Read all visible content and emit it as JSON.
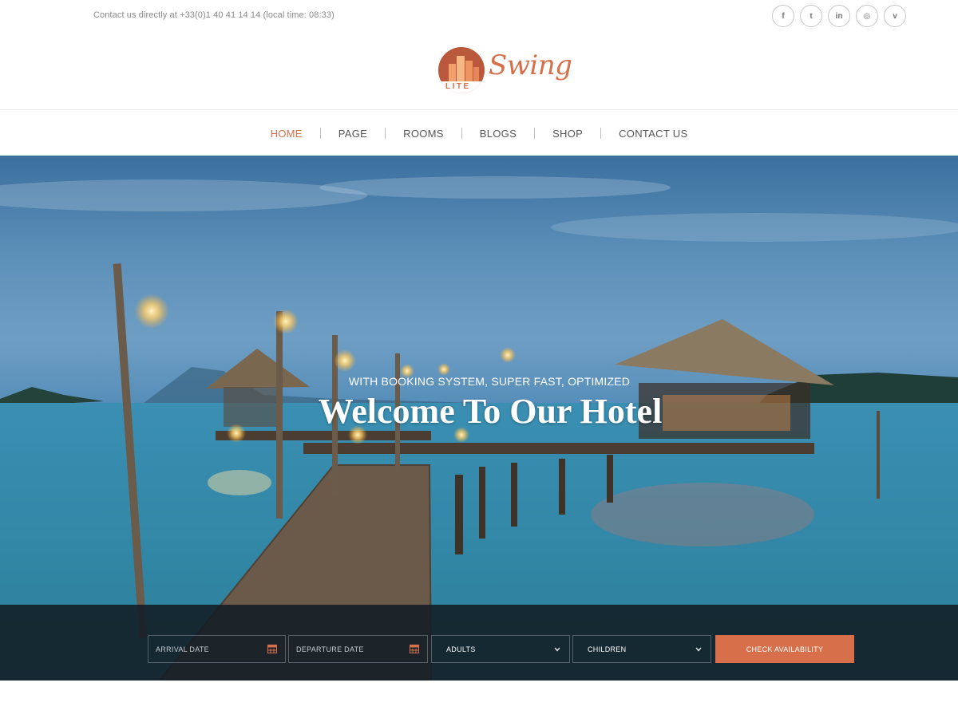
{
  "topbar": {
    "contact_text": "Contact us directly at +33(0)1 40 41 14 14 (local time: 08:33)",
    "social": [
      {
        "icon": "facebook-icon",
        "glyph": "f"
      },
      {
        "icon": "twitter-icon",
        "glyph": "t"
      },
      {
        "icon": "linkedin-icon",
        "glyph": "in"
      },
      {
        "icon": "instagram-icon",
        "glyph": "◎"
      },
      {
        "icon": "vimeo-icon",
        "glyph": "v"
      }
    ]
  },
  "logo": {
    "word": "Swing",
    "tag": "LITE",
    "brand_color": "#d66f4a"
  },
  "nav": {
    "items": [
      {
        "label": "HOME",
        "active": true
      },
      {
        "label": "PAGE"
      },
      {
        "label": "ROOMS"
      },
      {
        "label": "BLOGS"
      },
      {
        "label": "SHOP"
      },
      {
        "label": "CONTACT US"
      }
    ]
  },
  "hero": {
    "subtitle": "WITH BOOKING SYSTEM, SUPER FAST, OPTIMIZED",
    "title": "Welcome To Our Hotel"
  },
  "booking": {
    "arrival_placeholder": "ARRIVAL DATE",
    "departure_placeholder": "DEPARTURE DATE",
    "adults_label": "ADULTS",
    "children_label": "CHILDREN",
    "check_button": "CHECK AVAILABILITY",
    "accent_color": "#d66f4a"
  }
}
